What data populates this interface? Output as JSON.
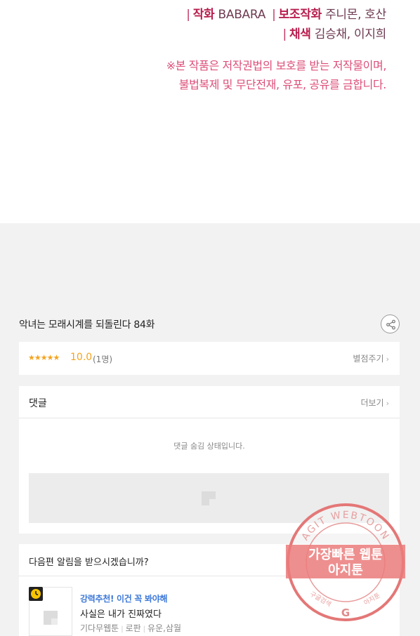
{
  "credits": {
    "line1": {
      "role1_label": "작화",
      "role1_value": "BABARA",
      "role2_label": "보조작화",
      "role2_value": "주니몬, 호산"
    },
    "line2": {
      "role_label": "채색",
      "role_value": "김승채, 이지희"
    },
    "notice_line1": "※본 작품은 저작권법의 보호를 받는 저작물이며,",
    "notice_line2": "불법복제 및 무단전재, 유포, 공유를 금합니다.",
    "separator": "|"
  },
  "episode": {
    "title": "악녀는 모래시계를 되돌린다 84화",
    "share_icon": "share-icon"
  },
  "rating": {
    "stars": "★★★★★",
    "score": "10.0",
    "count": "(1명)",
    "rate_link": "별점주기",
    "chevron": "›"
  },
  "comments": {
    "title": "댓글",
    "more_link": "더보기",
    "chevron": "›",
    "hidden_message": "댓글 숨김 상태입니다."
  },
  "notify": {
    "question": "다음편 알림을 받으시겠습니까?",
    "recommend": {
      "tag": "강력추천! 이건 꼭 봐야해",
      "title": "사실은 내가 진짜였다",
      "meta": [
        "기다무웹툰",
        "로판",
        "유운,삼월"
      ]
    }
  },
  "watermark": {
    "arc_text": "AGIT WEBTOON",
    "line1": "가장빠른 웹툰",
    "line2": "아지툰",
    "bottom_left": "구글검색",
    "bottom_right": "아지툰",
    "logo_letter": "G"
  },
  "colors": {
    "credit_accent": "#b81e4e",
    "notice": "#dd4f79",
    "rating": "#f5a31c",
    "recommend_tag": "#3c78d8",
    "watermark": "#e05a5a"
  }
}
